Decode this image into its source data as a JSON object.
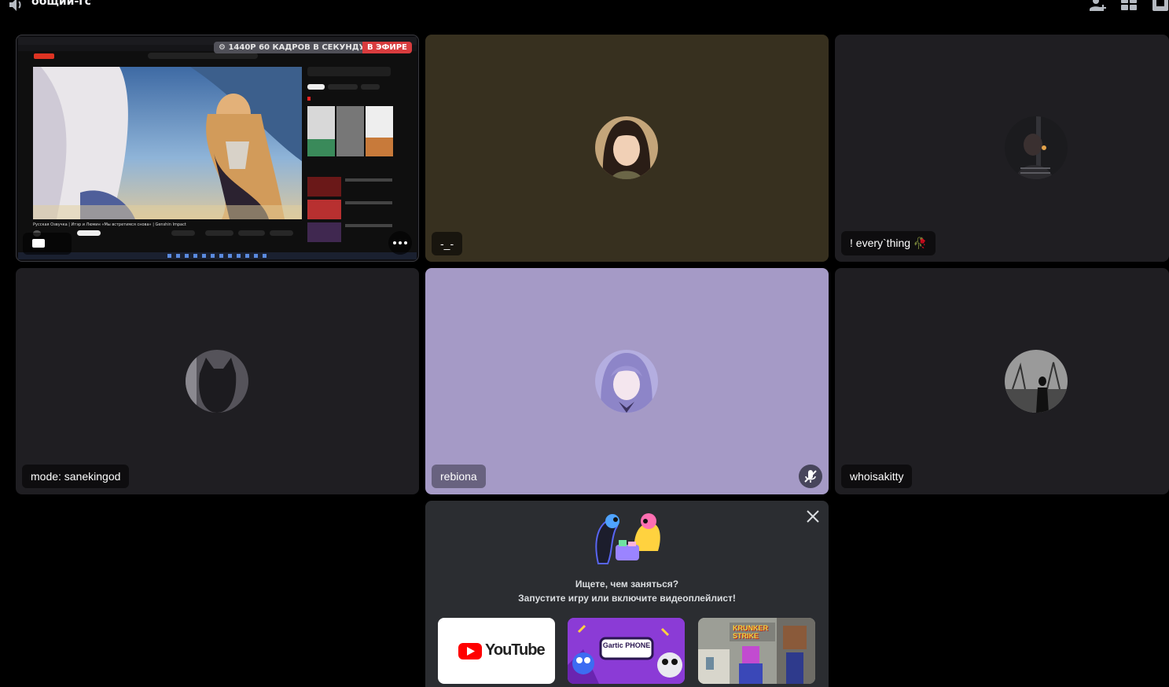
{
  "channel": {
    "name": "общий-гс"
  },
  "stream": {
    "quality_badge": "⚙ 1440P 60 КАДРОВ В СЕКУНДУ",
    "live_badge": "В ЭФИРЕ",
    "video_caption": "Русская Озвучка | Итэр и Люмин «Мы встретимся снова» | Genshin Impact"
  },
  "participants": [
    {
      "name": "-_-"
    },
    {
      "name": "! every`thing 🥀"
    },
    {
      "name": "mode: sanekingod"
    },
    {
      "name": "rebiona"
    },
    {
      "name": "whoisakitty"
    }
  ],
  "activity": {
    "title": "Ищете, чем заняться?",
    "subtitle": "Запустите игру или включите видеоплейлист!",
    "cards": [
      {
        "name": "YouTube"
      },
      {
        "name": "Gartic PHONE"
      },
      {
        "name": "KRUNKER STRIKE"
      }
    ]
  },
  "colors": {
    "tile_dark": "#1f1e22",
    "tile_brown": "#37301f",
    "tile_lavender": "#a59ac6",
    "live_red": "#d83c3e",
    "activity_bg": "#2b2d31"
  }
}
